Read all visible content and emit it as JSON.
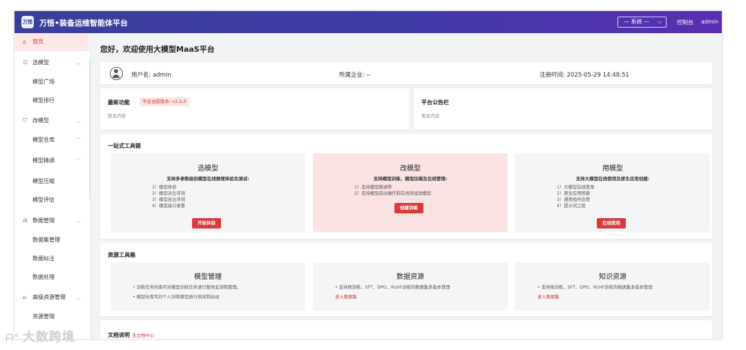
{
  "header": {
    "logo_text": "万悟",
    "title": "万悟•装备运维智能体平台",
    "system_select": "— 系统 —",
    "console_link": "控制台",
    "user": "admin"
  },
  "sidebar": {
    "items": [
      {
        "label": "首页",
        "icon": "home-icon"
      },
      {
        "label": "选模型",
        "icon": "grid-icon"
      },
      {
        "label": "模型广场"
      },
      {
        "label": "模型排行"
      },
      {
        "label": "改模型",
        "icon": "filter-icon"
      },
      {
        "label": "模型仓库"
      },
      {
        "label": "模型精调"
      },
      {
        "label": "模型压缩"
      },
      {
        "label": "模型评估"
      },
      {
        "label": "数据管理",
        "icon": "bar-chart-icon"
      },
      {
        "label": "数据集管理"
      },
      {
        "label": "数据标注"
      },
      {
        "label": "数据处理"
      },
      {
        "label": "高级资源管理",
        "icon": "bank-icon"
      },
      {
        "label": "资源管理"
      }
    ]
  },
  "main": {
    "welcome": "您好，欢迎使用大模型MaaS平台",
    "user_info": {
      "username": "用户名: admin",
      "company": "所属企业: --",
      "registered": "注册时间: 2025-05-29 14:48:51"
    },
    "latest": {
      "title": "最新功能",
      "version": "平台当前版本: v2.5.0",
      "empty": "暂无内容"
    },
    "notice": {
      "title": "平台公告栏",
      "empty": "暂无内容"
    },
    "toolchain": {
      "title": "一站式工具链",
      "tools": [
        {
          "title": "选模型",
          "desc": "支持多参数级别模型在线推理体验及测试:",
          "items": [
            "1）模型体验",
            "2）模型对比评测",
            "3）模型自主评测",
            "4）模型接口查看"
          ],
          "button": "开始体验"
        },
        {
          "title": "改模型",
          "desc": "支持模型训练、模型压缩及在线管理:",
          "items": [
            "1）支持模型微调等",
            "2）支持模型自动操作和在线测试改模型"
          ],
          "button": "创建训练"
        },
        {
          "title": "用模型",
          "desc": "支持大模型在线使用及原生应用创建:",
          "items": [
            "1）大模型在线使用",
            "2）原生应用搭建",
            "3）通用组件应用",
            "4）提示词工程"
          ],
          "button": "在线使用"
        }
      ]
    },
    "resources": {
      "title": "资源工具箱",
      "boxes": [
        {
          "title": "模型管理",
          "items": [
            "• 训练任务列表可对模型训练任务进行整体监测和管理。",
            "• 模型仓库可对个人训练模型进行测试和启动"
          ]
        },
        {
          "title": "数据资源",
          "items": [
            "• 支持预训练、SFT、DPO、RLHF训练的数据集多版本管理"
          ],
          "link": "进入数据集"
        },
        {
          "title": "知识资源",
          "items": [
            "• 支持预训练、SFT、DPO、RLHF训练的数据集多版本管理"
          ],
          "link": "进入数据集"
        }
      ]
    },
    "docs": {
      "title": "文档说明",
      "link": "去文档中心"
    }
  },
  "watermark": "大数跨境",
  "colors": {
    "header_start": "#3a3f9a",
    "header_end": "#5a2fb3",
    "accent": "#d93a3a",
    "highlight_card": "#fbe3e3"
  }
}
